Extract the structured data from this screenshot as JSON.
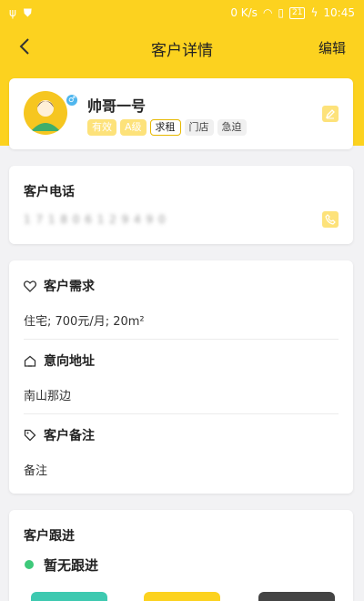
{
  "status": {
    "net": "0 K/s",
    "battery": "21",
    "time": "10:45"
  },
  "nav": {
    "title": "客户详情",
    "edit": "编辑"
  },
  "profile": {
    "name": "帅哥一号",
    "gender_symbol": "♂",
    "tags": [
      "有效",
      "A级",
      "求租",
      "门店",
      "急迫"
    ]
  },
  "phone": {
    "label": "客户电话",
    "value": "1 7 1 8 0 6 1 2 9 4 9 0"
  },
  "demand": {
    "label": "客户需求",
    "value": "住宅; 700元/月; 20m²"
  },
  "address": {
    "label": "意向地址",
    "value": "南山那边"
  },
  "remark": {
    "label": "客户备注",
    "value": "备注"
  },
  "follow": {
    "label": "客户跟进",
    "status": "暂无跟进"
  },
  "colors": {
    "accent": "#fcd21f",
    "tag_yellow": "#fde27a",
    "follow_dot": "#3ec97a"
  }
}
